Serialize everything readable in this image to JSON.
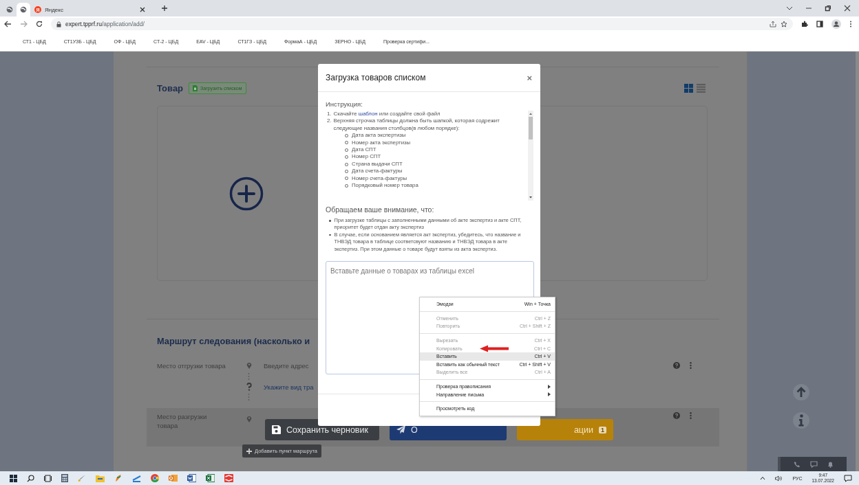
{
  "browser": {
    "tabs": [
      {
        "kind": "globe",
        "selected": false
      },
      {
        "kind": "globe",
        "selected": true
      },
      {
        "kind": "site",
        "favicon_letter": "Я",
        "title": "Яндекс",
        "selected": false
      }
    ],
    "url_host": "expert.tpprf.ru",
    "url_path": "/application/add/",
    "bookmarks": [
      "СТ1 - ЦБД",
      "СТ1УЗБ - ЦБД",
      "ОФ - ЦБД",
      "СТ-2 - ЦБД",
      "EAV - ЦБД",
      "СТ1ГЗ - ЦБД",
      "ФормаА - ЦБД",
      "ЗЕРНО - ЦБД",
      "Проверка сертифи..."
    ]
  },
  "page": {
    "product_heading": "Товар",
    "upload_button": "Загрузить списком",
    "view_toggle": [
      {
        "kind": "grid",
        "selected": true
      },
      {
        "kind": "list",
        "selected": false
      }
    ],
    "route_heading": "Маршрут следования (насколько и",
    "route_rows": [
      {
        "kind": "address",
        "label": "Место отгрузки товара",
        "value": "Введите адрес",
        "highlighted": false
      },
      {
        "kind": "transport",
        "value": "Укажите вид тра"
      },
      {
        "kind": "address",
        "label": "Место разгрузки товара",
        "highlighted": true
      }
    ],
    "sticky_buttons": [
      {
        "kind": "draft",
        "label": "Сохранить черновик"
      },
      {
        "kind": "send",
        "label": "О"
      },
      {
        "kind": "submit",
        "label": "ации",
        "badge": "1"
      }
    ],
    "add_point_button": "Добавить пункт маршрута"
  },
  "modal": {
    "title": "Загрузка товаров списком",
    "close": "×",
    "instruction_heading": "Инструкция:",
    "step_1": {
      "number": "1.",
      "before": "Скачайте ",
      "link": "шаблон",
      "after": " или создайте свой файл"
    },
    "step_2": {
      "number": "2.",
      "text": "Верхняя строчка таблицы должна быть шапкой, которая содрежит следующие названия столбцов(в любом порядке):"
    },
    "columns": [
      "Дата акта экспертизы",
      "Номер акта экспертизы",
      "Дата СПТ",
      "Номер СПТ",
      "Страна выдачи СПТ",
      "Дата счета-фактуры",
      "Номер счета-фактуры",
      "Порядковый номер товара"
    ],
    "notice_heading": "Обращаем ваше внимание, что:",
    "notices": [
      "При загрузке таблицы с заполненными данными об акте экспертиз и акте СПТ, приоритет будет отдан акту экспертиз",
      "В случае, если основанием является акт экспертиз, убедитесь, что название и ТНВЭД товара в таблице соответсвуют названию и ТНВЭД товара в акте экспертиз. При этом данные о товаре будут взяты из акта экспертиз."
    ],
    "textarea_placeholder": "Вставьте данные о товарах из таблицы excel"
  },
  "context_menu": [
    [
      {
        "label": "Эмодзи",
        "shortcut": "Win + Точка",
        "disabled": false,
        "selected": false
      }
    ],
    [
      {
        "label": "Отменить",
        "shortcut": "Ctrl + Z",
        "disabled": true,
        "selected": false
      },
      {
        "label": "Повторить",
        "shortcut": "Ctrl + Shift + Z",
        "disabled": true,
        "selected": false
      }
    ],
    [
      {
        "label": "Вырезать",
        "shortcut": "Ctrl + X",
        "disabled": true,
        "selected": false
      },
      {
        "label": "Копировать",
        "shortcut": "Ctrl + C",
        "disabled": true,
        "selected": false
      },
      {
        "label": "Вставить",
        "shortcut": "Ctrl + V",
        "disabled": false,
        "selected": true
      },
      {
        "label": "Вставить как обычный текст",
        "shortcut": "Ctrl + Shift + V",
        "disabled": false,
        "selected": false
      },
      {
        "label": "Выделить все",
        "shortcut": "Ctrl + A",
        "disabled": true,
        "selected": false
      }
    ],
    [
      {
        "label": "Проверка правописания",
        "submenu": true,
        "disabled": false,
        "selected": false
      },
      {
        "label": "Направление письма",
        "submenu": true,
        "disabled": false,
        "selected": false
      }
    ],
    [
      {
        "label": "Просмотреть код",
        "disabled": false,
        "selected": false
      }
    ]
  ],
  "taskbar": {
    "language": "РУС",
    "time": "9:47",
    "date": "13.07.2022"
  }
}
